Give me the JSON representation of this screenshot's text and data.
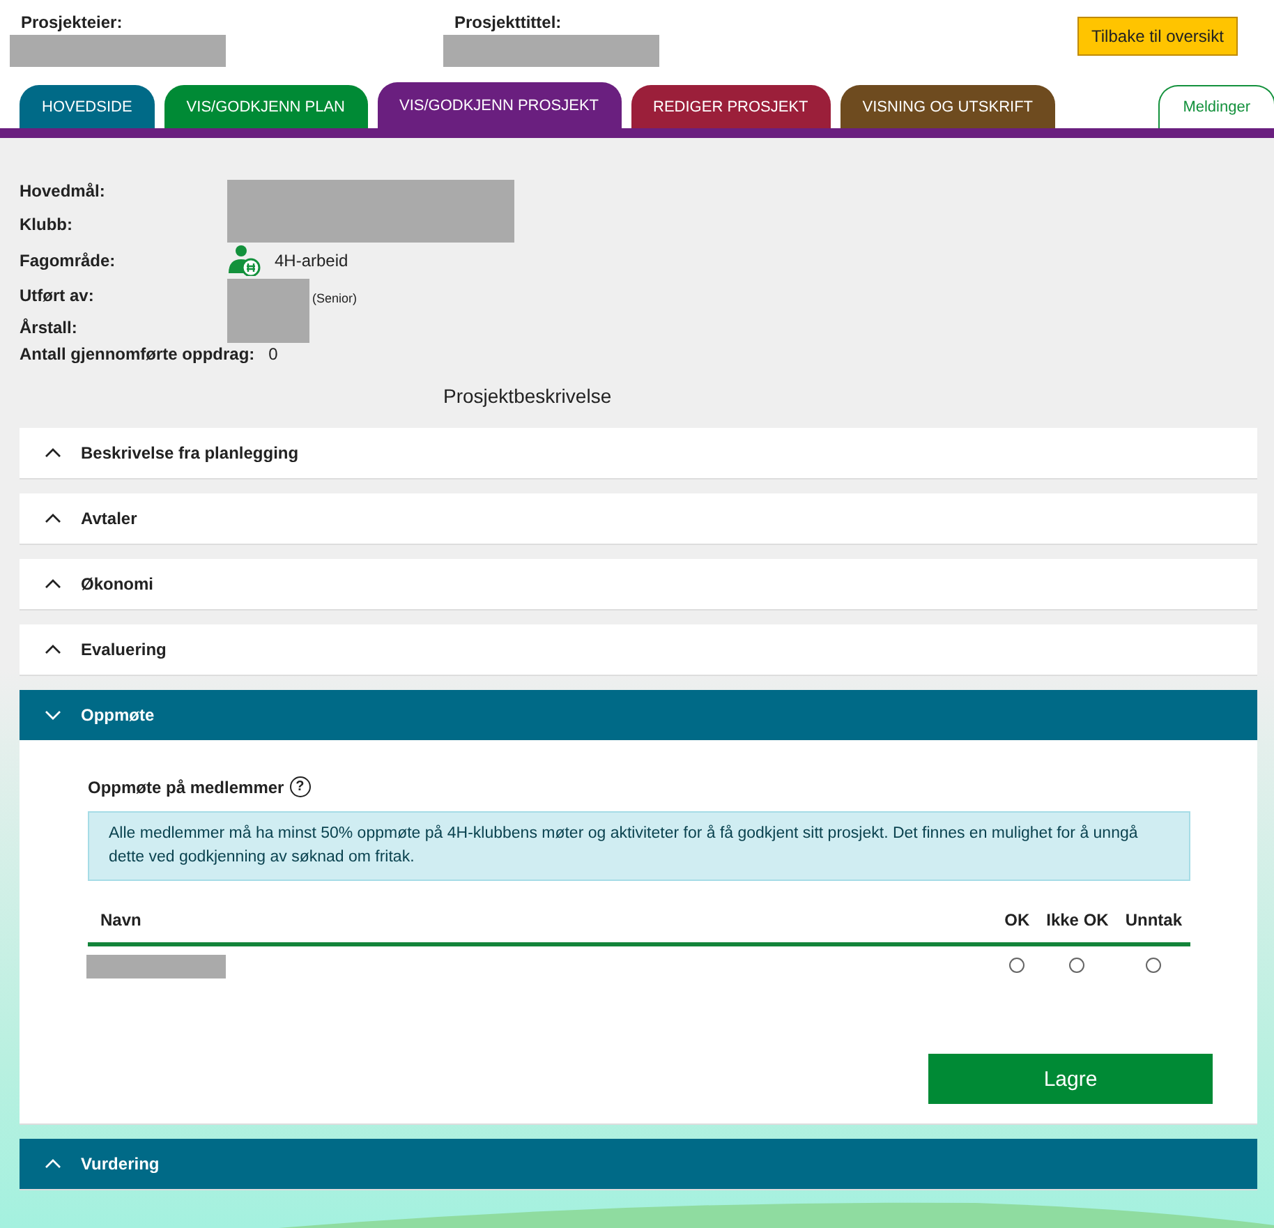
{
  "header": {
    "owner_label": "Prosjekteier:",
    "title_label": "Prosjekttittel:",
    "back_button": "Tilbake til oversikt"
  },
  "tabs": [
    {
      "label": "HOVEDSIDE",
      "color": "#006a87",
      "selected": false
    },
    {
      "label": "VIS/GODKJENN PLAN",
      "color": "#008a35",
      "selected": false
    },
    {
      "label": "VIS/GODKJENN PROSJEKT",
      "color": "#6a1f7f",
      "selected": true
    },
    {
      "label": "REDIGER PROSJEKT",
      "color": "#9b1f3a",
      "selected": false
    },
    {
      "label": "VISNING OG UTSKRIFT",
      "color": "#6e4b1f",
      "selected": false
    }
  ],
  "messages_tab": "Meldinger",
  "info": {
    "goal_label": "Hovedmål:",
    "club_label": "Klubb:",
    "field_label": "Fagområde:",
    "field_value": "4H-arbeid",
    "done_by_label": "Utført av:",
    "done_by_note": "(Senior)",
    "year_label": "Årstall:",
    "count_label": "Antall gjennomførte oppdrag:",
    "count_value": "0"
  },
  "description_title": "Prosjektbeskrivelse",
  "sections": [
    {
      "title": "Beskrivelse fra planlegging",
      "expanded": false,
      "highlighted": false
    },
    {
      "title": "Avtaler",
      "expanded": false,
      "highlighted": false
    },
    {
      "title": "Økonomi",
      "expanded": false,
      "highlighted": false
    },
    {
      "title": "Evaluering",
      "expanded": false,
      "highlighted": false
    },
    {
      "title": "Oppmøte",
      "expanded": true,
      "highlighted": true
    },
    {
      "title": "Vurdering",
      "expanded": false,
      "highlighted": true
    }
  ],
  "attendance": {
    "title": "Oppmøte på medlemmer",
    "help_icon": "?",
    "notice": "Alle medlemmer må ha minst 50% oppmøte på 4H-klubbens møter og aktiviteter for å få godkjent sitt prosjekt. Det finnes en mulighet for å unngå dette ved godkjenning av søknad om fritak.",
    "columns": [
      "Navn",
      "OK",
      "Ikke OK",
      "Unntak"
    ],
    "rows": [
      {
        "options": [
          {
            "checked": false
          },
          {
            "checked": false
          },
          {
            "checked": false
          }
        ]
      }
    ],
    "save_button": "Lagre"
  }
}
